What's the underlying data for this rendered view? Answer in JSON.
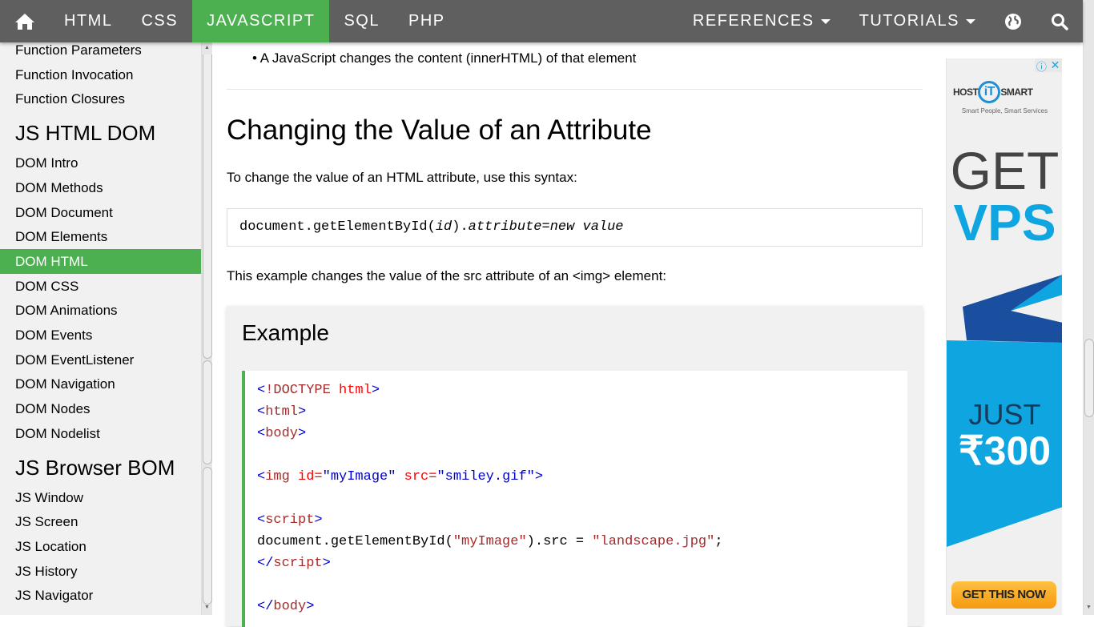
{
  "nav": {
    "items": [
      "HTML",
      "CSS",
      "JAVASCRIPT",
      "SQL",
      "PHP"
    ],
    "active": 2,
    "references": "REFERENCES",
    "tutorials": "TUTORIALS",
    "icons": [
      "home-icon",
      "globe-icon",
      "search-icon"
    ],
    "colors": {
      "bar": "#5f5f5f",
      "active": "#4CAF50"
    }
  },
  "sidebar": {
    "items_top": [
      "Function Parameters",
      "Function Invocation",
      "Function Closures"
    ],
    "heading1": "JS HTML DOM",
    "dom_items": [
      "DOM Intro",
      "DOM Methods",
      "DOM Document",
      "DOM Elements",
      "DOM HTML",
      "DOM CSS",
      "DOM Animations",
      "DOM Events",
      "DOM EventListener",
      "DOM Navigation",
      "DOM Nodes",
      "DOM Nodelist"
    ],
    "active": "DOM HTML",
    "heading2": "JS Browser BOM",
    "bom_items": [
      "JS Window",
      "JS Screen",
      "JS Location",
      "JS History",
      "JS Navigator"
    ]
  },
  "main": {
    "bullet": "A JavaScript changes the content (innerHTML) of that element",
    "heading": "Changing the Value of an Attribute",
    "intro": "To change the value of an HTML attribute, use this syntax:",
    "syntax": [
      {
        "t": "document.getElementById(",
        "i": false
      },
      {
        "t": "id",
        "i": true
      },
      {
        "t": ").",
        "i": false
      },
      {
        "t": "attribute",
        "i": true
      },
      {
        "t": "=",
        "i": false
      },
      {
        "t": "new value",
        "i": true
      }
    ],
    "desc": "This example changes the value of the src attribute of an <img> element:",
    "example_title": "Example",
    "code": [
      [
        {
          "t": "<",
          "c": "b"
        },
        {
          "t": "!DOCTYPE",
          "c": "n"
        },
        {
          "t": " html",
          "c": "a"
        },
        {
          "t": ">",
          "c": "b"
        }
      ],
      [
        {
          "t": "<",
          "c": "b"
        },
        {
          "t": "html",
          "c": "n"
        },
        {
          "t": ">",
          "c": "b"
        }
      ],
      [
        {
          "t": "<",
          "c": "b"
        },
        {
          "t": "body",
          "c": "n"
        },
        {
          "t": ">",
          "c": "b"
        }
      ],
      [],
      [
        {
          "t": "<",
          "c": "b"
        },
        {
          "t": "img",
          "c": "n"
        },
        {
          "t": " id=",
          "c": "a"
        },
        {
          "t": "\"myImage\"",
          "c": "b"
        },
        {
          "t": " src=",
          "c": "a"
        },
        {
          "t": "\"smiley.gif\"",
          "c": "b"
        },
        {
          "t": ">",
          "c": "b"
        }
      ],
      [],
      [
        {
          "t": "<",
          "c": "b"
        },
        {
          "t": "script",
          "c": "n"
        },
        {
          "t": ">",
          "c": "b"
        }
      ],
      [
        {
          "t": "document.getElementById(",
          "c": "k"
        },
        {
          "t": "\"myImage\"",
          "c": "n"
        },
        {
          "t": ").src = ",
          "c": "k"
        },
        {
          "t": "\"landscape.jpg\"",
          "c": "n"
        },
        {
          "t": ";",
          "c": "k"
        }
      ],
      [
        {
          "t": "</",
          "c": "b"
        },
        {
          "t": "script",
          "c": "n"
        },
        {
          "t": ">",
          "c": "b"
        }
      ],
      [],
      [
        {
          "t": "</",
          "c": "b"
        },
        {
          "t": "body",
          "c": "n"
        },
        {
          "t": ">",
          "c": "b"
        }
      ]
    ],
    "code_colors": {
      "b": "#0000cd",
      "n": "#a52a2a",
      "a": "#ff0000",
      "k": "#000000"
    }
  },
  "ad": {
    "brand_left": "HOST",
    "brand_mid": "iT",
    "brand_right": "SMART",
    "tagline": "Smart People, Smart Services",
    "line1": "GET",
    "line2": "VPS",
    "line3": "JUST",
    "price": "₹300",
    "cta": "GET THIS NOW",
    "colors": {
      "blue": "#0ea5e0",
      "dark": "#1a4fa0",
      "cta": "#f7a21b"
    }
  }
}
